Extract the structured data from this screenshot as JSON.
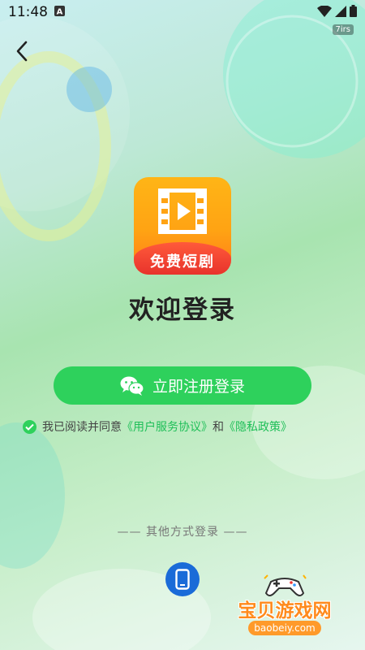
{
  "status_bar": {
    "time": "11:48",
    "notification_icon": "a-letter-icon",
    "tag": "7irs",
    "icons": [
      "wifi-icon",
      "signal-icon",
      "battery-icon"
    ]
  },
  "nav": {
    "back_icon": "back-chevron-icon"
  },
  "app": {
    "logo_text": "免费短剧",
    "welcome_title": "欢迎登录"
  },
  "login": {
    "button_label": "立即注册登录",
    "button_icon": "wechat-icon",
    "accent": "#2ed15c"
  },
  "agreement": {
    "prefix": "我已阅读并同意",
    "terms_link": "《用户服务协议》",
    "conjunction": "和",
    "privacy_link": "《隐私政策》",
    "checked": true
  },
  "other_login": {
    "label": "—— 其他方式登录 ——",
    "phone_icon": "mobile-phone-icon"
  },
  "watermark": {
    "text": "宝贝游戏网",
    "url": "baobeiy.com"
  }
}
